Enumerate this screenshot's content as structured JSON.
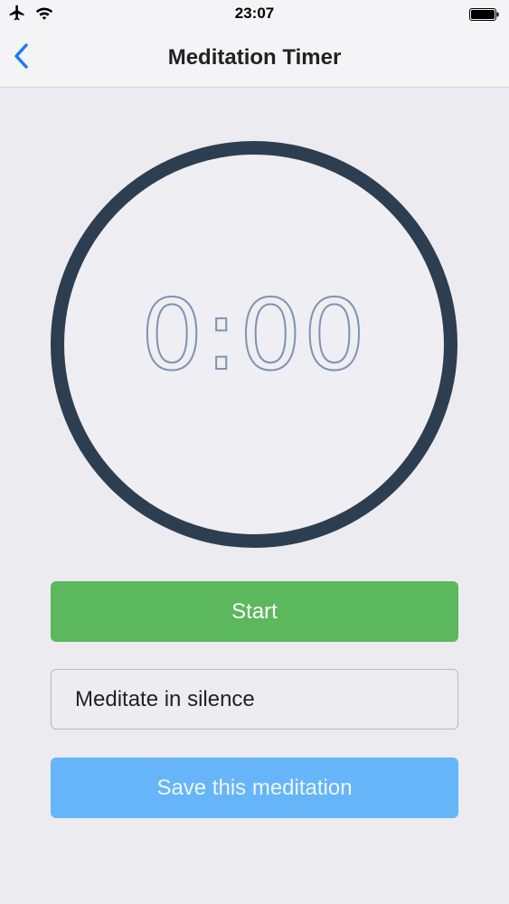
{
  "status_bar": {
    "time": "23:07",
    "icons": [
      "airplane-icon",
      "wifi-icon",
      "battery-icon"
    ]
  },
  "nav": {
    "title": "Meditation Timer",
    "back_icon": "chevron-left-icon"
  },
  "timer": {
    "display": "0:00"
  },
  "buttons": {
    "start_label": "Start",
    "sound_label": "Meditate in silence",
    "save_label": "Save this meditation"
  },
  "colors": {
    "accent_blue": "#1a7cf2",
    "ring": "#2d3e50",
    "start_green": "#5cb85c",
    "save_blue": "#66b5f8",
    "timer_digits": "#7f93b0"
  }
}
